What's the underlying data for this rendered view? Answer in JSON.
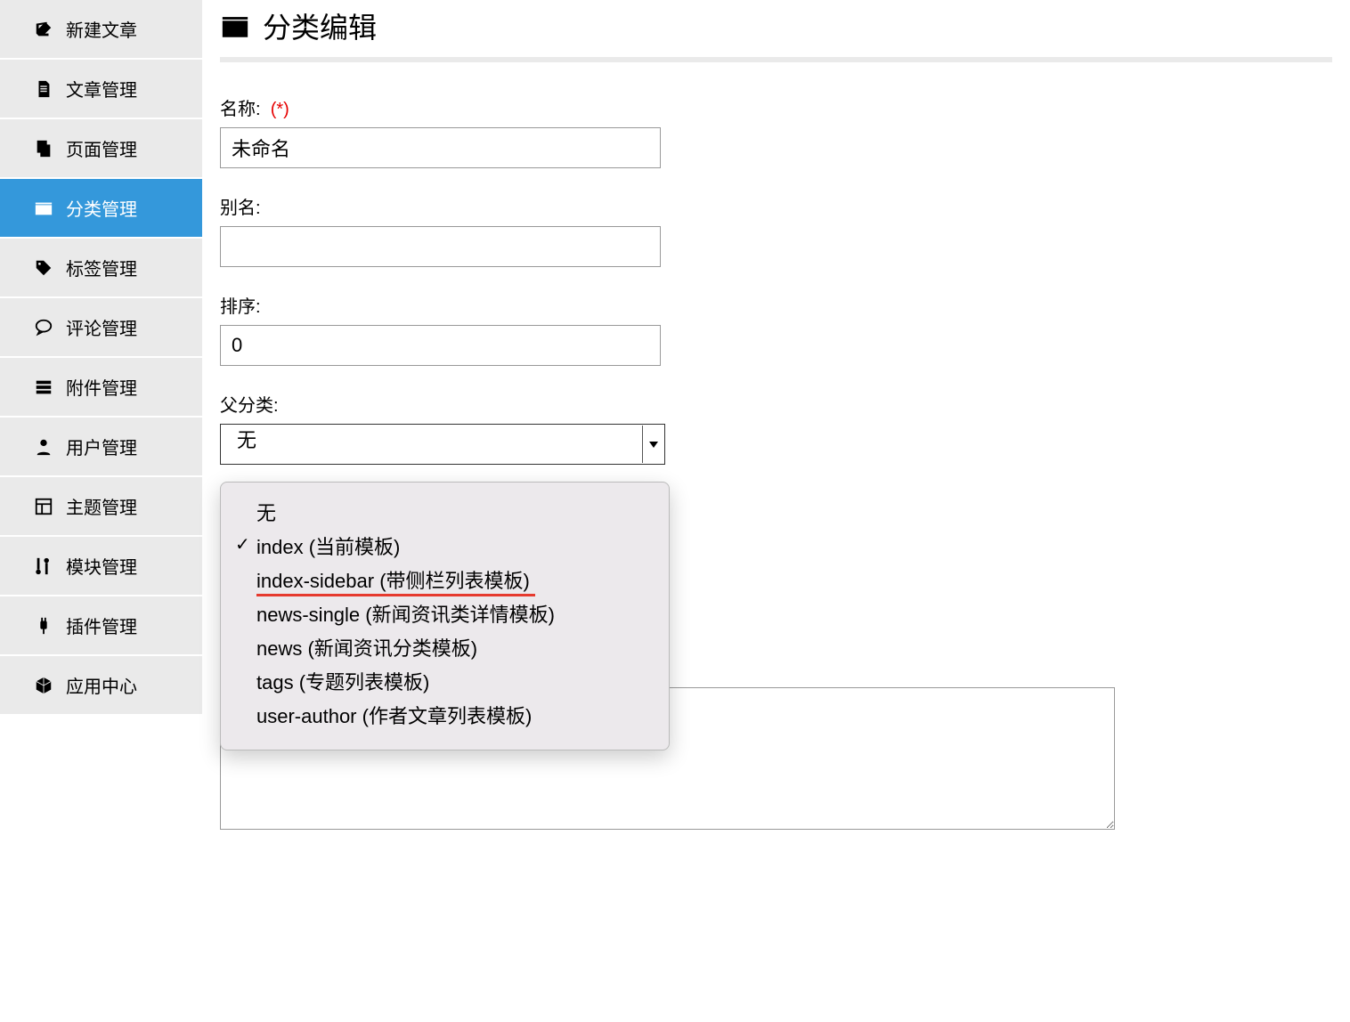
{
  "sidebar": {
    "items": [
      {
        "id": "new-post",
        "label": "新建文章",
        "icon": "edit"
      },
      {
        "id": "posts",
        "label": "文章管理",
        "icon": "doc"
      },
      {
        "id": "pages",
        "label": "页面管理",
        "icon": "copy"
      },
      {
        "id": "categories",
        "label": "分类管理",
        "icon": "folder",
        "active": true
      },
      {
        "id": "tags",
        "label": "标签管理",
        "icon": "tag"
      },
      {
        "id": "comments",
        "label": "评论管理",
        "icon": "comment"
      },
      {
        "id": "attachments",
        "label": "附件管理",
        "icon": "server"
      },
      {
        "id": "users",
        "label": "用户管理",
        "icon": "user"
      },
      {
        "id": "themes",
        "label": "主题管理",
        "icon": "layout"
      },
      {
        "id": "modules",
        "label": "模块管理",
        "icon": "key"
      },
      {
        "id": "plugins",
        "label": "插件管理",
        "icon": "plug"
      },
      {
        "id": "apps",
        "label": "应用中心",
        "icon": "cube"
      }
    ]
  },
  "page": {
    "title": "分类编辑"
  },
  "form": {
    "name_label": "名称:",
    "required_mark": "(*)",
    "name_value": "未命名",
    "alias_label": "别名:",
    "alias_value": "",
    "sort_label": "排序:",
    "sort_value": "0",
    "parent_label": "父分类:",
    "parent_selected": "无"
  },
  "dropdown": {
    "options": [
      {
        "label": "无",
        "checked": false
      },
      {
        "label": "index (当前模板)",
        "checked": true
      },
      {
        "label": "index-sidebar (带侧栏列表模板)",
        "checked": false,
        "highlight": true
      },
      {
        "label": "news-single (新闻资讯类详情模板)",
        "checked": false
      },
      {
        "label": "news (新闻资讯分类模板)",
        "checked": false
      },
      {
        "label": "tags (专题列表模板)",
        "checked": false
      },
      {
        "label": "user-author (作者文章列表模板)",
        "checked": false
      }
    ]
  }
}
